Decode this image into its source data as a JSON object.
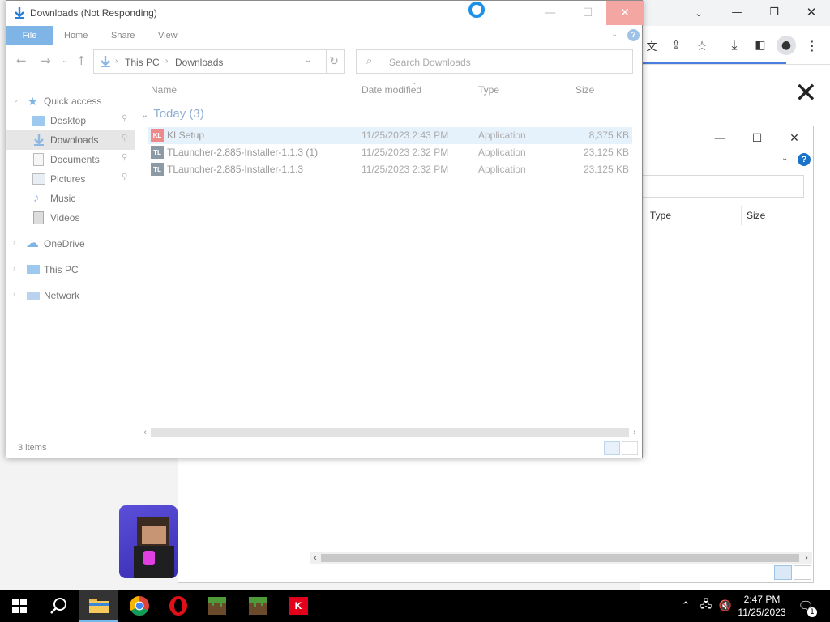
{
  "window": {
    "title": "Downloads (Not Responding)",
    "minimize": "—",
    "maximize": "☐",
    "close": "✕"
  },
  "ribbon": {
    "tabs": [
      "File",
      "Home",
      "Share",
      "View"
    ],
    "help": "?"
  },
  "address": {
    "crumbs": [
      "This PC",
      "Downloads"
    ],
    "search_placeholder": "Search Downloads"
  },
  "nav": {
    "quick_access": "Quick access",
    "items": [
      "Desktop",
      "Downloads",
      "Documents",
      "Pictures",
      "Music",
      "Videos"
    ],
    "onedrive": "OneDrive",
    "this_pc": "This PC",
    "network": "Network"
  },
  "columns": {
    "name": "Name",
    "date": "Date modified",
    "type": "Type",
    "size": "Size"
  },
  "group": {
    "label": "Today (3)"
  },
  "files": [
    {
      "name": "KLSetup",
      "date": "11/25/2023 2:43 PM",
      "type": "Application",
      "size": "8,375 KB",
      "icon": "KL"
    },
    {
      "name": "TLauncher-2.885-Installer-1.1.3 (1)",
      "date": "11/25/2023 2:32 PM",
      "type": "Application",
      "size": "23,125 KB",
      "icon": "TL"
    },
    {
      "name": "TLauncher-2.885-Installer-1.1.3",
      "date": "11/25/2023 2:32 PM",
      "type": "Application",
      "size": "23,125 KB",
      "icon": "TL"
    }
  ],
  "status": {
    "items": "3 items"
  },
  "background_window": {
    "columns": {
      "type": "Type",
      "size": "Size"
    },
    "minimize": "—",
    "maximize": "☐",
    "close": "✕",
    "help": "?"
  },
  "chrome": {
    "close_overlay": "✕"
  },
  "taskbar": {
    "time": "2:47 PM",
    "date": "11/25/2023",
    "notification_count": "1",
    "kl_label": "K"
  },
  "colors": {
    "accent": "#1e90e8",
    "file_tab": "#7fb5e6",
    "close_hover": "#f4a6a2",
    "selection": "#e5f1fb",
    "taskbar": "#000000",
    "kaspersky": "#e3001b",
    "opera": "#e0101a"
  }
}
